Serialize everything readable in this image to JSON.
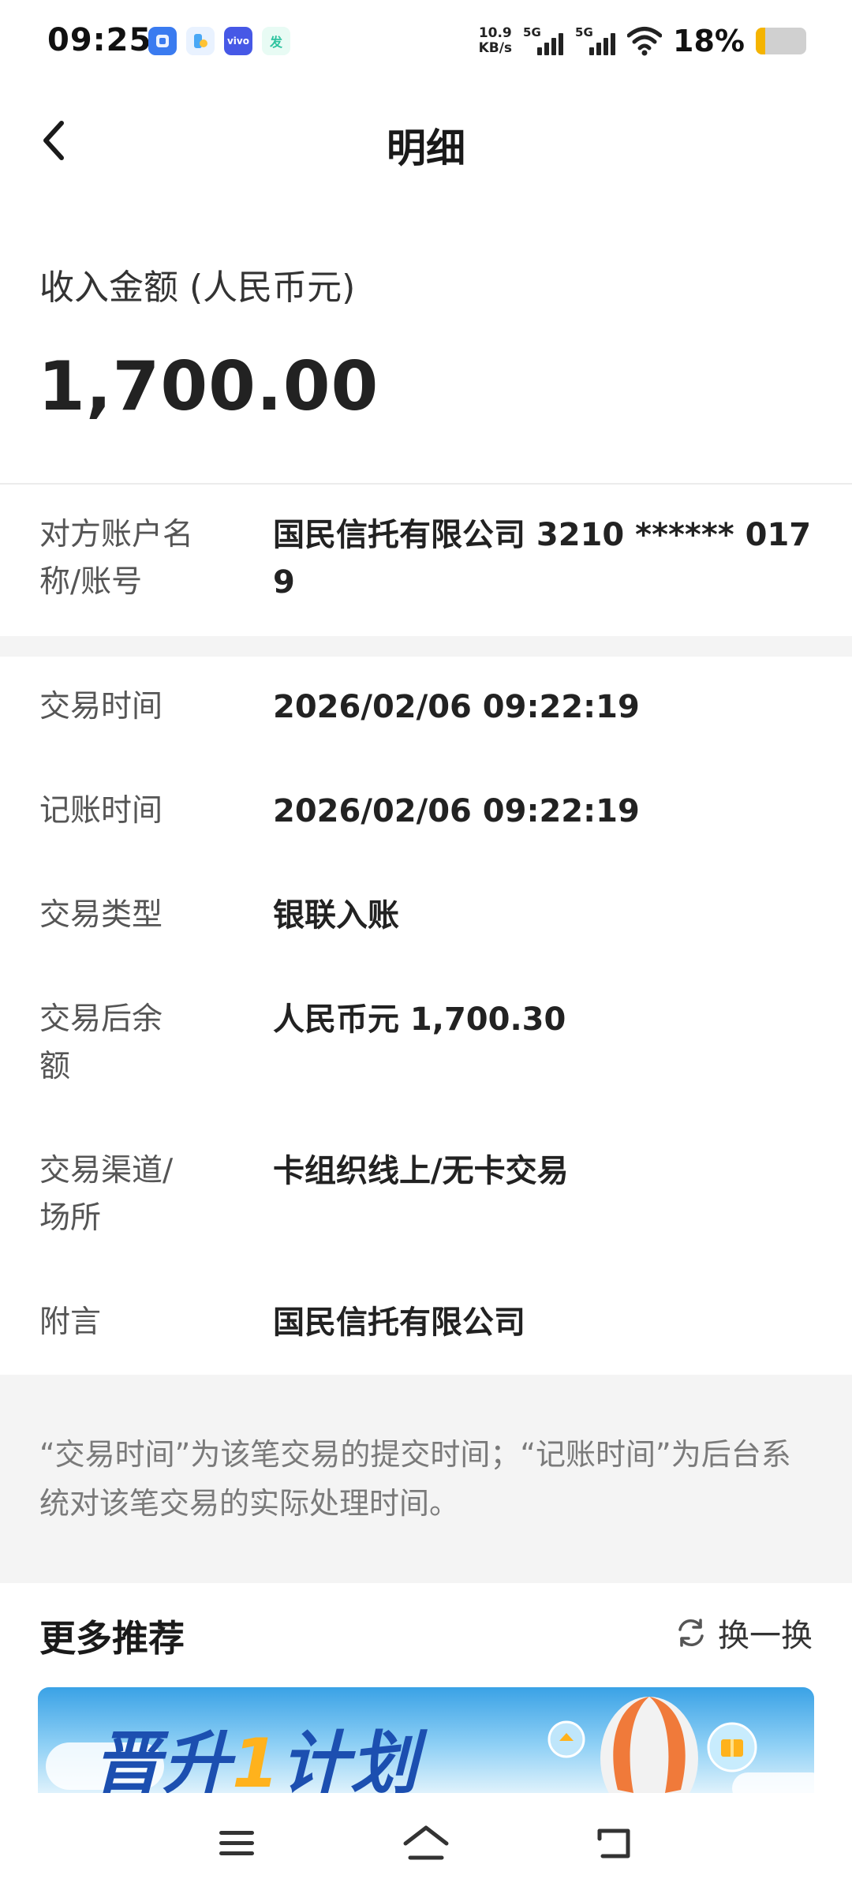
{
  "status_bar": {
    "time": "09:25",
    "net_speed_value": "10.9",
    "net_speed_unit": "KB/s",
    "signal_1_label": "5G",
    "signal_2_label": "5G",
    "battery_percent": "18%",
    "battery_level": 0.18,
    "apps": [
      {
        "name": "app-icon-1",
        "color": "#3a7bf0"
      },
      {
        "name": "app-icon-2",
        "color": "#4aa8f5"
      },
      {
        "name": "vivo-icon",
        "color": "#4658e6",
        "text": "vivo"
      },
      {
        "name": "app-icon-4",
        "color": "#2fc4a0",
        "text": "发"
      }
    ]
  },
  "header": {
    "title": "明细",
    "back_icon": "chevron-left-icon"
  },
  "amount": {
    "label": "收入金额 (人民币元)",
    "value": "1,700.00"
  },
  "counterparty": {
    "label": "对方账户名称/账号",
    "value": "国民信托有限公司 3210 ****** 0179"
  },
  "details": [
    {
      "label": "交易时间",
      "value": "2026/02/06 09:22:19"
    },
    {
      "label": "记账时间",
      "value": "2026/02/06 09:22:19"
    },
    {
      "label": "交易类型",
      "value": "银联入账"
    },
    {
      "label": "交易后余额",
      "value": "人民币元 1,700.30"
    },
    {
      "label": "交易渠道/场所",
      "value": "卡组织线上/无卡交易"
    },
    {
      "label": "附言",
      "value": "国民信托有限公司"
    }
  ],
  "note": "“交易时间”为该笔交易的提交时间；“记账时间”为后台系统对该笔交易的实际处理时间。",
  "recommend": {
    "title": "更多推荐",
    "refresh_label": "换一换",
    "banner_text_prefix": "晋升",
    "banner_text_highlight": "1",
    "banner_text_suffix": "计划"
  },
  "colors": {
    "accent_banner": "#1c4fb0",
    "battery": "#f5b400"
  }
}
